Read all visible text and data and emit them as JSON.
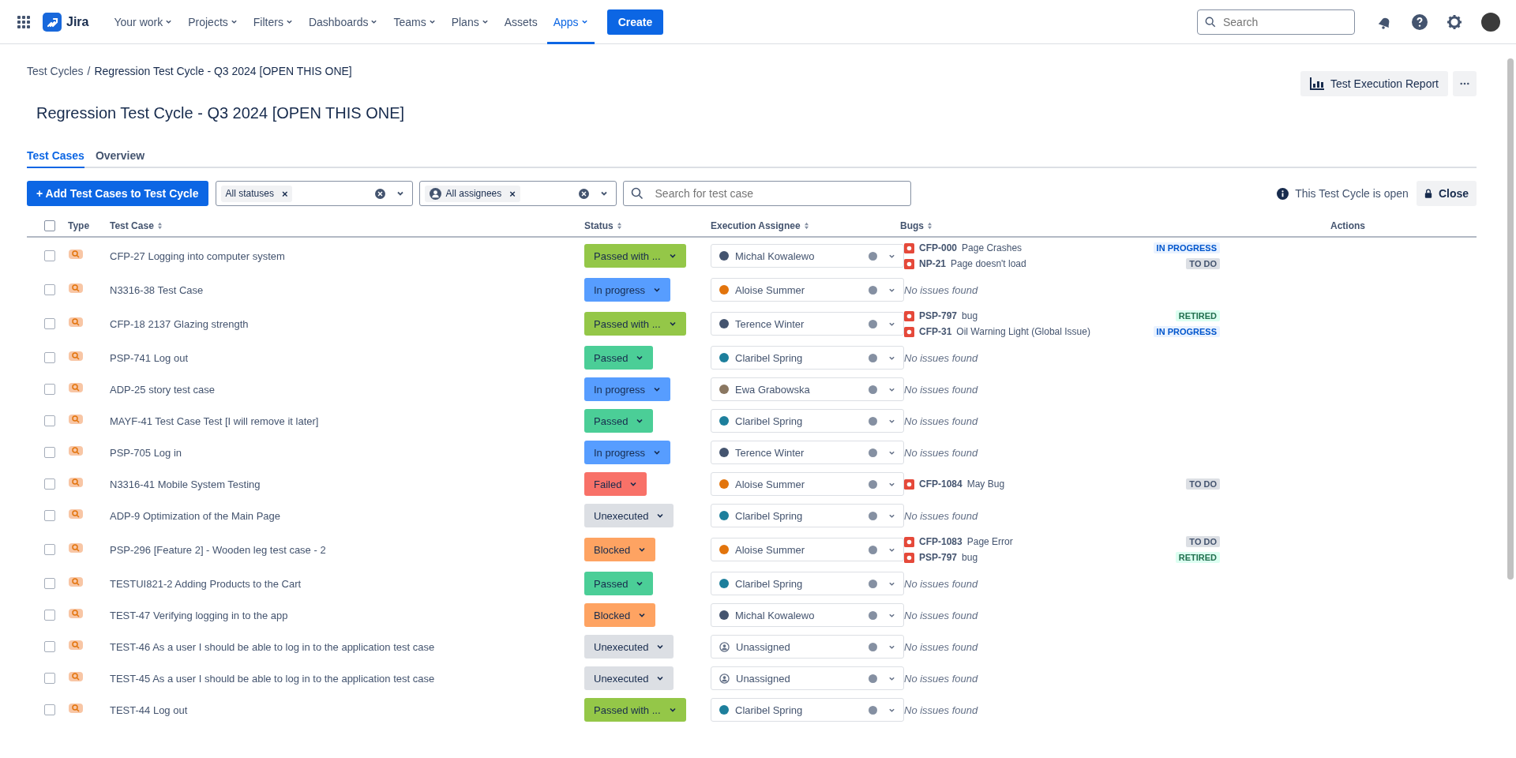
{
  "nav": {
    "product": "Jira",
    "items": [
      {
        "label": "Your work",
        "dropdown": true,
        "selected": false
      },
      {
        "label": "Projects",
        "dropdown": true,
        "selected": false
      },
      {
        "label": "Filters",
        "dropdown": true,
        "selected": false
      },
      {
        "label": "Dashboards",
        "dropdown": true,
        "selected": false
      },
      {
        "label": "Teams",
        "dropdown": true,
        "selected": false
      },
      {
        "label": "Plans",
        "dropdown": true,
        "selected": false
      },
      {
        "label": "Assets",
        "dropdown": false,
        "selected": false
      },
      {
        "label": "Apps",
        "dropdown": true,
        "selected": true
      }
    ],
    "create": "Create",
    "search": {
      "placeholder": "Search"
    }
  },
  "breadcrumb": {
    "parent": "Test Cycles",
    "separator": "/",
    "current": "Regression Test Cycle - Q3 2024 [OPEN THIS ONE]"
  },
  "report_button": "Test Execution Report",
  "title": "Regression Test Cycle - Q3 2024 [OPEN THIS ONE]",
  "tabs": [
    {
      "label": "Test Cases",
      "selected": true
    },
    {
      "label": "Overview",
      "selected": false
    }
  ],
  "toolbar": {
    "add_button": "+ Add Test Cases to Test Cycle",
    "status_filter": {
      "chip": "All statuses",
      "remove": "×"
    },
    "assignee_filter": {
      "chip": "All assignees",
      "remove": "×"
    },
    "search": {
      "placeholder": "Search for test case"
    },
    "cycle_state": "This Test Cycle is open",
    "close_button": "Close"
  },
  "table": {
    "select_all_checked": false,
    "columns": [
      "Type",
      "Test Case",
      "Status",
      "Execution Assignee",
      "Bugs",
      "Actions"
    ],
    "rows": [
      {
        "checked": false,
        "test_case": "CFP-27 Logging into computer system",
        "status": {
          "label": "Passed with ...",
          "color": "#94c748"
        },
        "assignee": {
          "name": "Michal Kowalewo",
          "color": "#44546f"
        },
        "bugs": [
          {
            "key": "CFP-000",
            "summary": "Page Crashes",
            "status": "IN PROGRESS",
            "kind": "progress"
          },
          {
            "key": "NP-21",
            "summary": "Page doesn't load",
            "status": "TO DO",
            "kind": "todo"
          }
        ]
      },
      {
        "checked": false,
        "test_case": "N3316-38 Test Case",
        "status": {
          "label": "In progress",
          "color": "#579dff"
        },
        "assignee": {
          "name": "Aloise Summer",
          "color": "#e2740c"
        },
        "bugs": [],
        "empty": "No issues found"
      },
      {
        "checked": false,
        "test_case": "CFP-18 2137 Glazing strength",
        "status": {
          "label": "Passed with ...",
          "color": "#94c748"
        },
        "assignee": {
          "name": "Terence Winter",
          "color": "#44546f"
        },
        "bugs": [
          {
            "key": "PSP-797",
            "summary": "bug",
            "status": "RETIRED",
            "kind": "done"
          },
          {
            "key": "CFP-31",
            "summary": "Oil Warning Light (Global Issue)",
            "status": "IN PROGRESS",
            "kind": "progress"
          }
        ]
      },
      {
        "checked": false,
        "test_case": "PSP-741 Log out",
        "status": {
          "label": "Passed",
          "color": "#4bce97"
        },
        "assignee": {
          "name": "Claribel Spring",
          "color": "#1d7f9c"
        },
        "bugs": [],
        "empty": "No issues found"
      },
      {
        "checked": false,
        "test_case": "ADP-25 story test case",
        "status": {
          "label": "In progress",
          "color": "#579dff"
        },
        "assignee": {
          "name": "Ewa Grabowska",
          "color": "#8a7761"
        },
        "bugs": [],
        "empty": "No issues found"
      },
      {
        "checked": false,
        "test_case": "MAYF-41 Test Case Test [I will remove it later]",
        "status": {
          "label": "Passed",
          "color": "#4bce97"
        },
        "assignee": {
          "name": "Claribel Spring",
          "color": "#1d7f9c"
        },
        "bugs": [],
        "empty": "No issues found"
      },
      {
        "checked": false,
        "test_case": "PSP-705 Log in",
        "status": {
          "label": "In progress",
          "color": "#579dff"
        },
        "assignee": {
          "name": "Terence Winter",
          "color": "#44546f"
        },
        "bugs": [],
        "empty": "No issues found"
      },
      {
        "checked": false,
        "test_case": "N3316-41 Mobile System Testing",
        "status": {
          "label": "Failed",
          "color": "#f87168"
        },
        "assignee": {
          "name": "Aloise Summer",
          "color": "#e2740c"
        },
        "bugs": [
          {
            "key": "CFP-1084",
            "summary": "May Bug",
            "status": "TO DO",
            "kind": "todo"
          }
        ]
      },
      {
        "checked": false,
        "test_case": "ADP-9 Optimization of the Main Page",
        "status": {
          "label": "Unexecuted",
          "color": "#dcdfe4"
        },
        "assignee": {
          "name": "Claribel Spring",
          "color": "#1d7f9c"
        },
        "bugs": [],
        "empty": "No issues found"
      },
      {
        "checked": false,
        "test_case": "PSP-296 [Feature 2] - Wooden leg test case - 2",
        "status": {
          "label": "Blocked",
          "color": "#fea362"
        },
        "assignee": {
          "name": "Aloise Summer",
          "color": "#e2740c"
        },
        "bugs": [
          {
            "key": "CFP-1083",
            "summary": "Page Error",
            "status": "TO DO",
            "kind": "todo"
          },
          {
            "key": "PSP-797",
            "summary": "bug",
            "status": "RETIRED",
            "kind": "done"
          }
        ]
      },
      {
        "checked": false,
        "test_case": "TESTUI821-2 Adding Products to the Cart",
        "status": {
          "label": "Passed",
          "color": "#4bce97"
        },
        "assignee": {
          "name": "Claribel Spring",
          "color": "#1d7f9c"
        },
        "bugs": [],
        "empty": "No issues found"
      },
      {
        "checked": false,
        "test_case": "TEST-47 Verifying logging in to the app",
        "status": {
          "label": "Blocked",
          "color": "#fea362"
        },
        "assignee": {
          "name": "Michal Kowalewo",
          "color": "#44546f"
        },
        "bugs": [],
        "empty": "No issues found"
      },
      {
        "checked": false,
        "test_case": "TEST-46 As a user I should be able to log in to the application test case",
        "status": {
          "label": "Unexecuted",
          "color": "#dcdfe4"
        },
        "assignee": {
          "name": "Unassigned",
          "kind": "unassigned"
        },
        "bugs": [],
        "empty": "No issues found"
      },
      {
        "checked": false,
        "test_case": "TEST-45 As a user I should be able to log in to the application test case",
        "status": {
          "label": "Unexecuted",
          "color": "#dcdfe4"
        },
        "assignee": {
          "name": "Unassigned",
          "kind": "unassigned"
        },
        "bugs": [],
        "empty": "No issues found"
      },
      {
        "checked": false,
        "test_case": "TEST-44 Log out",
        "status": {
          "label": "Passed with ...",
          "color": "#94c748"
        },
        "assignee": {
          "name": "Claribel Spring",
          "color": "#1d7f9c"
        },
        "bugs": [],
        "empty": "No issues found"
      }
    ]
  }
}
